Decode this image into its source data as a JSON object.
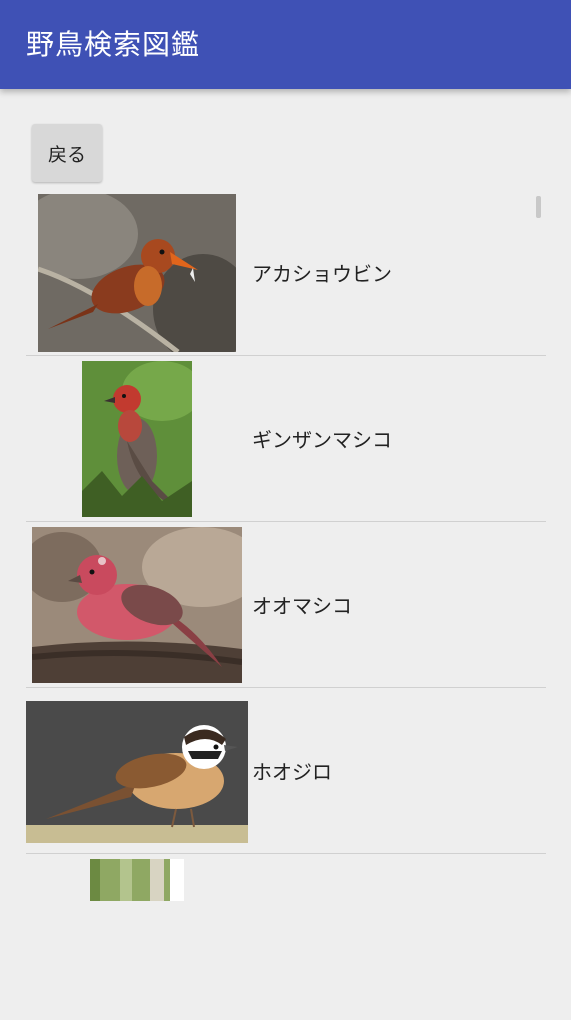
{
  "appbar": {
    "title": "野鳥検索図鑑",
    "color": "#3f51b5"
  },
  "back_button": {
    "label": "戻る"
  },
  "birds": [
    {
      "name": "アカショウビン",
      "image": "ruddy-kingfisher-photo"
    },
    {
      "name": "ギンザンマシコ",
      "image": "pine-grosbeak-photo"
    },
    {
      "name": "オオマシコ",
      "image": "pallass-rosefinch-photo"
    },
    {
      "name": "ホオジロ",
      "image": "meadow-bunting-photo"
    }
  ]
}
